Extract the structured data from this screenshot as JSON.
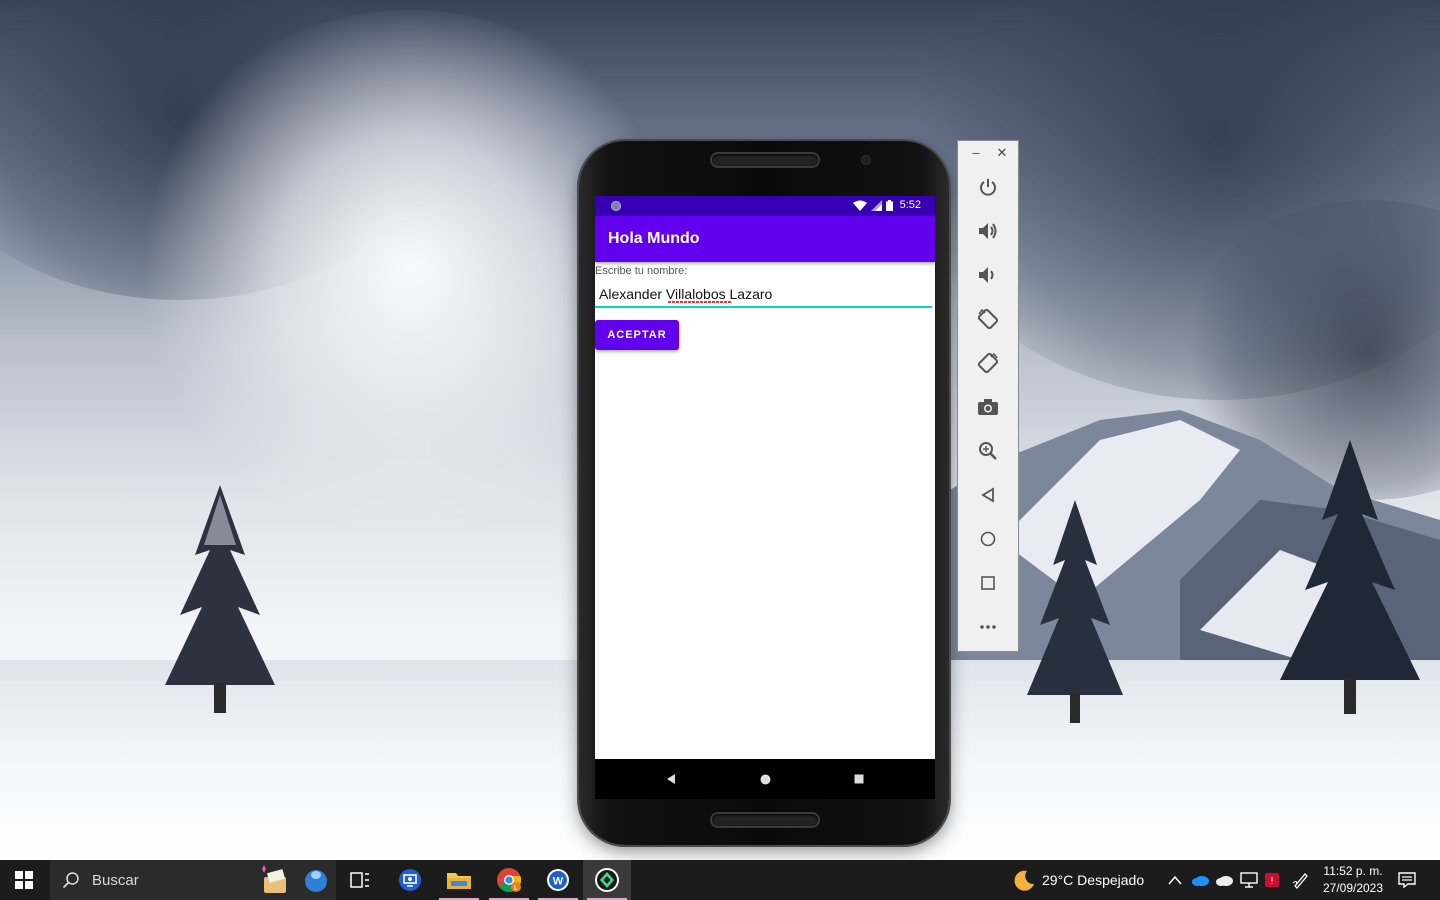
{
  "app": {
    "title": "Hola Mundo",
    "field_label": "Escribe tu nombre:",
    "name_value": "Alexander Villalobos Lazaro",
    "button_label": "ACEPTAR"
  },
  "phone_status": {
    "time": "5:52"
  },
  "emulator_toolbar": {
    "items": [
      "power-icon",
      "volume-up-icon",
      "volume-down-icon",
      "rotate-left-icon",
      "rotate-right-icon",
      "camera-icon",
      "zoom-icon",
      "back-icon",
      "home-icon",
      "overview-icon",
      "more-icon"
    ]
  },
  "taskbar": {
    "search_label": "Buscar",
    "weather": "29°C  Despejado",
    "time": "11:52 p. m.",
    "date": "27/09/2023"
  },
  "colors": {
    "primary": "#6200ee",
    "primary_dark": "#3700b3",
    "accent": "#03dac5"
  }
}
